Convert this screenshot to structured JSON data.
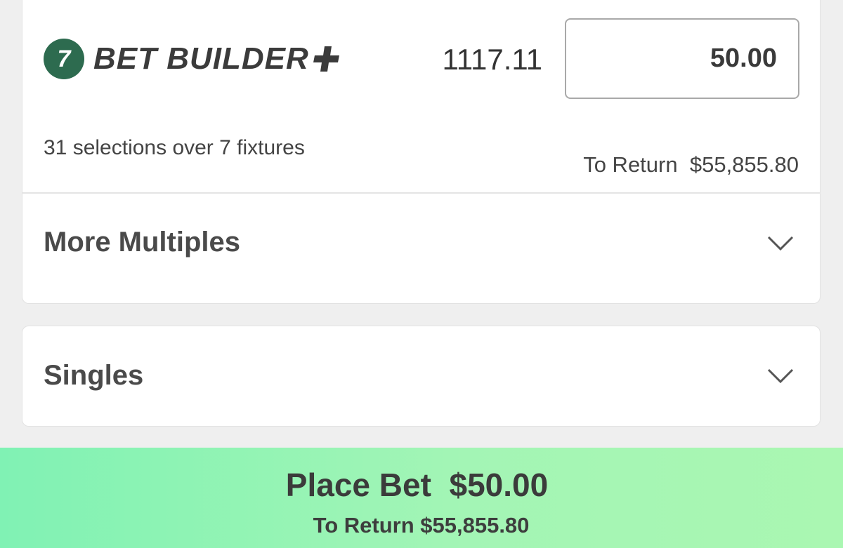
{
  "bet_builder": {
    "badge_number": "7",
    "title": "BET BUILDER",
    "plus_icon": "plus-icon",
    "odds": "1117.11",
    "stake_value": "50.00",
    "selections_text": "31 selections over 7 fixtures",
    "return_label": "To Return",
    "return_value": "$55,855.80",
    "badge_color": "#2d6b4f"
  },
  "sections": {
    "multiples": {
      "title": "More Multiples",
      "icon": "chevron-down-icon"
    },
    "singles": {
      "title": "Singles",
      "icon": "chevron-down-icon"
    }
  },
  "place_bet": {
    "label": "Place Bet",
    "amount": "$50.00",
    "return_label": "To Return",
    "return_value": "$55,855.80",
    "gradient_start": "#80f2b4",
    "gradient_end": "#aaf7b2"
  }
}
